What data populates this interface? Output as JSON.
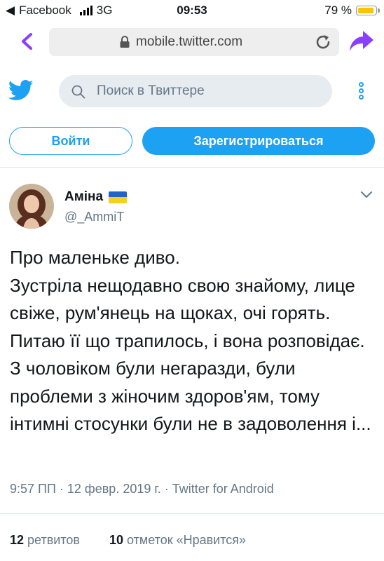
{
  "status_bar": {
    "carrier": "Facebook",
    "network": "3G",
    "time": "09:53",
    "battery": "79 %",
    "battery_level": 0.79
  },
  "browser": {
    "url": "mobile.twitter.com"
  },
  "twitter_header": {
    "search_placeholder": "Поиск в Твиттере"
  },
  "auth": {
    "login_label": "Войти",
    "signup_label": "Зарегистрироваться"
  },
  "tweet": {
    "author_name": "Аміна",
    "handle": "@_AmmiT",
    "text": "Про маленьке диво.\nЗустріла нещодавно свою знайому, лице свіже, рум'янець на щоках, очі горять. Питаю її що трапилось, і вона розповідає. З чоловіком були негаразди, були проблеми з жіночим здоров'ям, тому інтимні стосунки були не в задоволення і...",
    "meta": "9:57 ПП · 12 февр. 2019 г. · Twitter for Android",
    "retweets_count": "12",
    "retweets_label": "ретвитов",
    "likes_count": "10",
    "likes_label": "отметок «Нравится»"
  },
  "colors": {
    "twitter_blue": "#1da1f2",
    "browser_purple": "#8a3ffc",
    "text_gray": "#657786"
  }
}
